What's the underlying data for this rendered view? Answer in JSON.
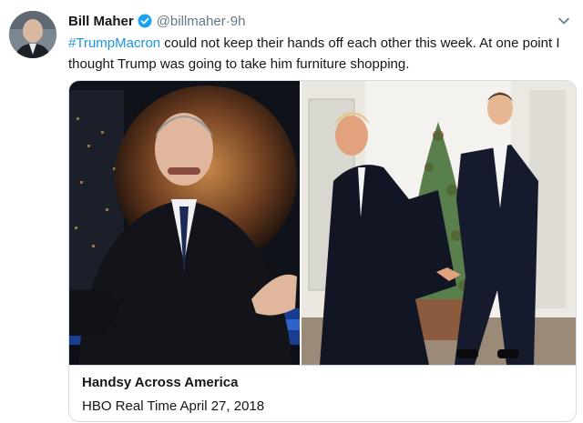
{
  "tweet": {
    "author_name": "Bill Maher",
    "handle": "@billmaher",
    "separator": " · ",
    "time": "9h",
    "hashtag": "#TrumpMacron",
    "text_rest": " could not keep their hands off each other this week. At one point I thought Trump was going to take him furniture shopping."
  },
  "card": {
    "title": "Handsy Across America",
    "subtitle": "HBO Real Time April 27, 2018"
  },
  "colors": {
    "link": "#1b95e0",
    "verified": "#1da1f2",
    "muted": "#657786",
    "border": "#d3dde4"
  },
  "icons": {
    "verified": "verified-badge-icon",
    "caret": "chevron-down-icon"
  }
}
